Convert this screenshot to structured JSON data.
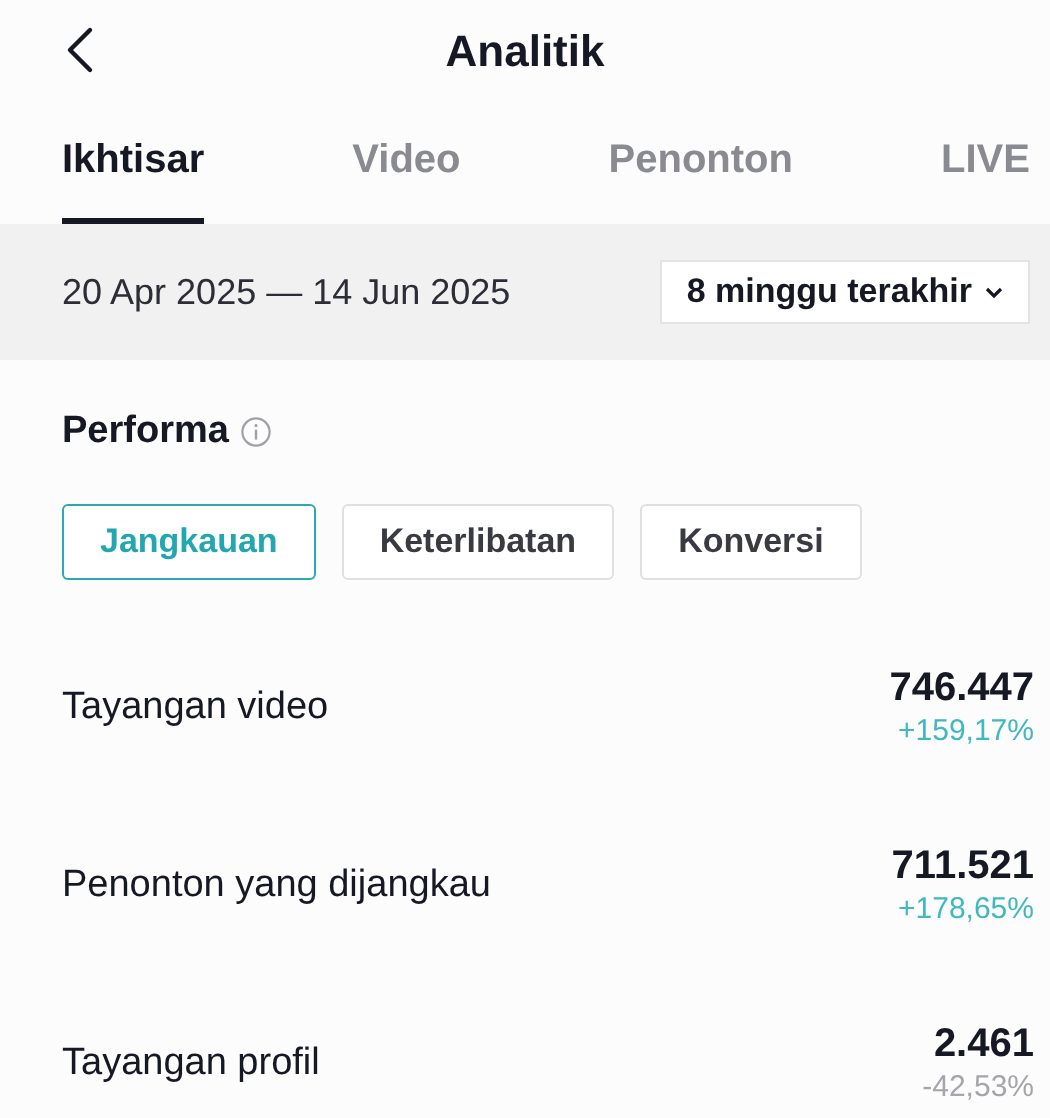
{
  "header": {
    "title": "Analitik"
  },
  "tabs": [
    {
      "label": "Ikhtisar",
      "selected": true
    },
    {
      "label": "Video",
      "selected": false
    },
    {
      "label": "Penonton",
      "selected": false
    },
    {
      "label": "LIVE",
      "selected": false
    }
  ],
  "date_range": {
    "text": "20 Apr 2025 — 14 Jun 2025",
    "period": "8 minggu terakhir"
  },
  "section": {
    "title": "Performa"
  },
  "filters": [
    {
      "label": "Jangkauan",
      "selected": true
    },
    {
      "label": "Keterlibatan",
      "selected": false
    },
    {
      "label": "Konversi",
      "selected": false
    }
  ],
  "metrics": [
    {
      "label": "Tayangan video",
      "value": "746.447",
      "change": "+159,17%",
      "color": "#3fb8bf"
    },
    {
      "label": "Penonton yang dijangkau",
      "value": "711.521",
      "change": "+178,65%",
      "color": "#3fb8bf"
    },
    {
      "label": "Tayangan profil",
      "value": "2.461",
      "change": "-42,53%",
      "color": "#a5a6aa"
    }
  ]
}
